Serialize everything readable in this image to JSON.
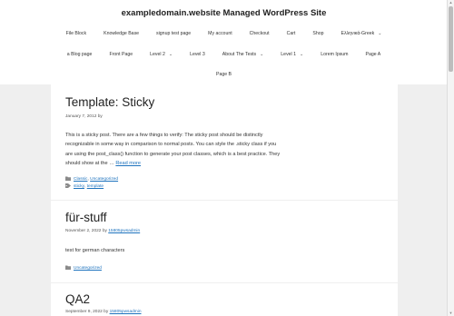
{
  "site": {
    "title": "exampledomain.website Managed WordPress Site"
  },
  "nav": {
    "row1": [
      {
        "label": "File Block"
      },
      {
        "label": "Knowledge Base"
      },
      {
        "label": "signup test page"
      },
      {
        "label": "My account"
      },
      {
        "label": "Checkout"
      },
      {
        "label": "Cart"
      },
      {
        "label": "Shop"
      },
      {
        "label": "Ελληνικά-Greek"
      }
    ],
    "row2": [
      {
        "label": "a Blog page"
      },
      {
        "label": "Front Page"
      },
      {
        "label": "Level 2"
      },
      {
        "label": "Level 3"
      },
      {
        "label": "About The Tests"
      },
      {
        "label": "Level 1"
      },
      {
        "label": "Lorem Ipsum"
      },
      {
        "label": "Page A"
      }
    ],
    "row3": [
      {
        "label": "Page B"
      }
    ],
    "dropdown_glyph": "⌄"
  },
  "posts": [
    {
      "title": "Template: Sticky",
      "date": "January 7, 2012",
      "by": "by",
      "excerpt": "This is a sticky post. There are a few things to verify: The sticky post should be distinctly recognizable in some way in comparison to normal posts. You can style the .sticky class if you are using the post_class() function to generate your post classes, which is a best practice. They should show at the …",
      "read_more": "Read more",
      "categories": [
        "Classic",
        "Uncategorized"
      ],
      "tags": [
        "sticky",
        "template"
      ]
    },
    {
      "title": "für-stuff",
      "date": "November 2, 2022",
      "by": "by",
      "author": "15805pwsadmin",
      "excerpt": "test for german characters",
      "categories": [
        "Uncategorized"
      ]
    },
    {
      "title": "QA2",
      "date": "September 9, 2022",
      "by": "by",
      "author": "15805pwsadmin"
    }
  ],
  "icons": {
    "category": "folder-icon",
    "tag": "tag-icon"
  }
}
